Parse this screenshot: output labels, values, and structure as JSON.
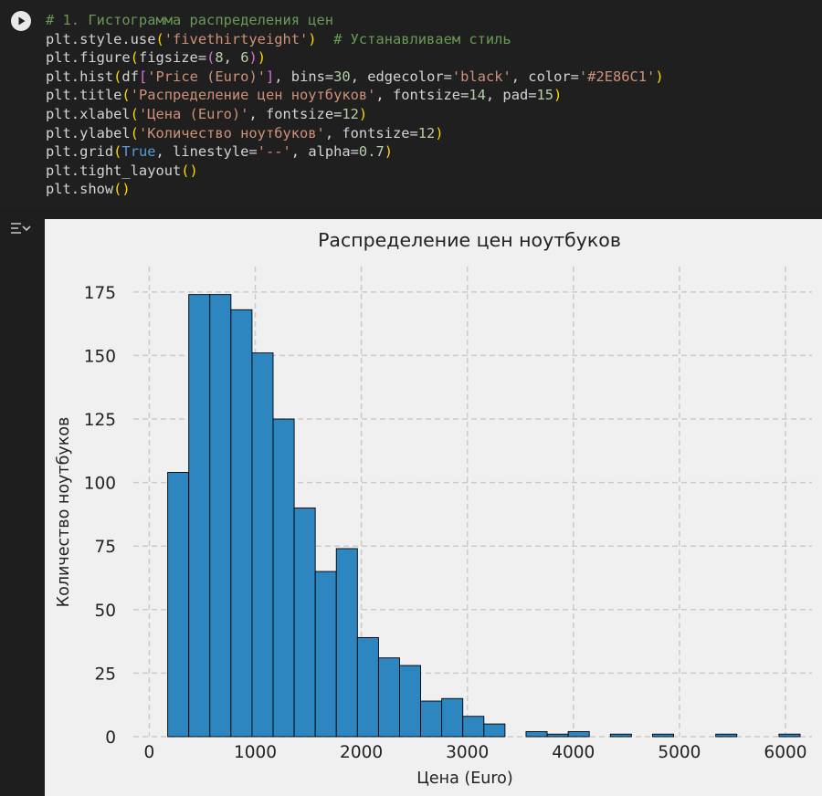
{
  "code_lines": [
    [
      {
        "t": "# 1. Гистограмма распределения цен",
        "c": "c-com"
      }
    ],
    [
      {
        "t": "plt.style.use"
      },
      {
        "t": "(",
        "c": "c-p1"
      },
      {
        "t": "'fivethirtyeight'",
        "c": "c-str"
      },
      {
        "t": ")",
        "c": "c-p1"
      },
      {
        "t": "  "
      },
      {
        "t": "# Устанавливаем стиль",
        "c": "c-com"
      }
    ],
    [
      {
        "t": "plt.figure"
      },
      {
        "t": "(",
        "c": "c-p1"
      },
      {
        "t": "figsize="
      },
      {
        "t": "(",
        "c": "c-p2"
      },
      {
        "t": "8",
        "c": "c-num"
      },
      {
        "t": ", "
      },
      {
        "t": "6",
        "c": "c-num"
      },
      {
        "t": ")",
        "c": "c-p2"
      },
      {
        "t": ")",
        "c": "c-p1"
      }
    ],
    [
      {
        "t": "plt.hist"
      },
      {
        "t": "(",
        "c": "c-p1"
      },
      {
        "t": "df"
      },
      {
        "t": "[",
        "c": "c-p2"
      },
      {
        "t": "'Price (Euro)'",
        "c": "c-str"
      },
      {
        "t": "]",
        "c": "c-p2"
      },
      {
        "t": ", bins="
      },
      {
        "t": "30",
        "c": "c-num"
      },
      {
        "t": ", edgecolor="
      },
      {
        "t": "'black'",
        "c": "c-str"
      },
      {
        "t": ", color="
      },
      {
        "t": "'#2E86C1'",
        "c": "c-str"
      },
      {
        "t": ")",
        "c": "c-p1"
      }
    ],
    [
      {
        "t": "plt.title"
      },
      {
        "t": "(",
        "c": "c-p1"
      },
      {
        "t": "'Распределение цен ноутбуков'",
        "c": "c-str"
      },
      {
        "t": ", fontsize="
      },
      {
        "t": "14",
        "c": "c-num"
      },
      {
        "t": ", pad="
      },
      {
        "t": "15",
        "c": "c-num"
      },
      {
        "t": ")",
        "c": "c-p1"
      }
    ],
    [
      {
        "t": "plt.xlabel"
      },
      {
        "t": "(",
        "c": "c-p1"
      },
      {
        "t": "'Цена (Euro)'",
        "c": "c-str"
      },
      {
        "t": ", fontsize="
      },
      {
        "t": "12",
        "c": "c-num"
      },
      {
        "t": ")",
        "c": "c-p1"
      }
    ],
    [
      {
        "t": "plt.ylabel"
      },
      {
        "t": "(",
        "c": "c-p1"
      },
      {
        "t": "'Количество ноутбуков'",
        "c": "c-str"
      },
      {
        "t": ", fontsize="
      },
      {
        "t": "12",
        "c": "c-num"
      },
      {
        "t": ")",
        "c": "c-p1"
      }
    ],
    [
      {
        "t": "plt.grid"
      },
      {
        "t": "(",
        "c": "c-p1"
      },
      {
        "t": "True",
        "c": "c-kw"
      },
      {
        "t": ", linestyle="
      },
      {
        "t": "'--'",
        "c": "c-str"
      },
      {
        "t": ", alpha="
      },
      {
        "t": "0.7",
        "c": "c-num"
      },
      {
        "t": ")",
        "c": "c-p1"
      }
    ],
    [
      {
        "t": "plt.tight_layout"
      },
      {
        "t": "()",
        "c": "c-p1"
      }
    ],
    [
      {
        "t": "plt.show"
      },
      {
        "t": "()",
        "c": "c-p1"
      }
    ]
  ],
  "icons": {
    "run": "play-icon",
    "output_toggle": "output-toggle-icon"
  },
  "chart_data": {
    "type": "bar",
    "title": "Распределение цен ноутбуков",
    "xlabel": "Цена (Euro)",
    "ylabel": "Количество ноутбуков",
    "xlim": [
      -150,
      6250
    ],
    "ylim": [
      0,
      185
    ],
    "xticks": [
      0,
      1000,
      2000,
      3000,
      4000,
      5000,
      6000
    ],
    "yticks": [
      0,
      25,
      50,
      75,
      100,
      125,
      150,
      175
    ],
    "bin_start": 174,
    "bin_width": 198.8,
    "values": [
      104,
      174,
      174,
      168,
      151,
      125,
      90,
      65,
      74,
      39,
      31,
      28,
      14,
      15,
      8,
      5,
      0,
      2,
      1,
      2,
      0,
      1,
      0,
      1,
      0,
      0,
      1,
      0,
      0,
      1
    ],
    "bar_color": "#2E86C1",
    "edge_color": "#000000",
    "grid": true
  }
}
